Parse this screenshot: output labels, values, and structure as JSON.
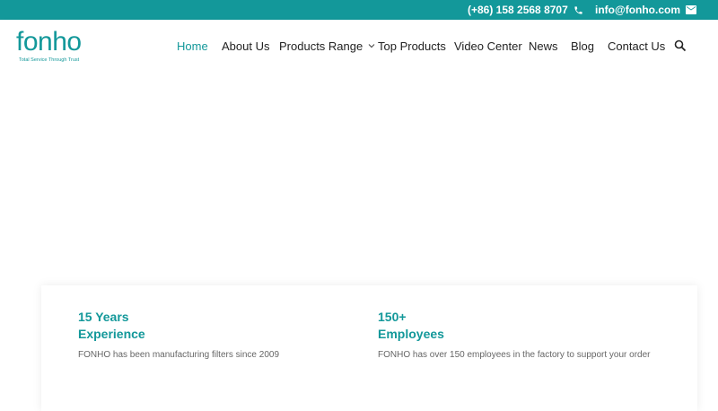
{
  "topbar": {
    "phone": "(+86) 158 2568 8707",
    "phone_icon": "phone-icon",
    "email": "info@fonho.com",
    "email_icon": "envelope-icon"
  },
  "brand": {
    "logo_text": "fonho",
    "tagline": "Total Service Through Trust",
    "accent_color": "#13989a"
  },
  "nav": {
    "items": [
      {
        "label": "Home",
        "active": true
      },
      {
        "label": "About Us"
      },
      {
        "label": "Products Range",
        "has_dropdown": true
      },
      {
        "label": "Top Products"
      },
      {
        "label": "Video Center"
      },
      {
        "label": "News"
      },
      {
        "label": "Blog"
      },
      {
        "label": "Contact Us"
      }
    ],
    "search_icon": "search-icon",
    "dropdown_icon": "chevron-down-icon"
  },
  "stats": [
    {
      "title_line1": "15 Years",
      "title_line2": "Experience",
      "description": "FONHO has been manufacturing filters since 2009"
    },
    {
      "title_line1": "150+",
      "title_line2": "Employees",
      "description": "FONHO has over 150 employees in the factory to support your order"
    }
  ]
}
